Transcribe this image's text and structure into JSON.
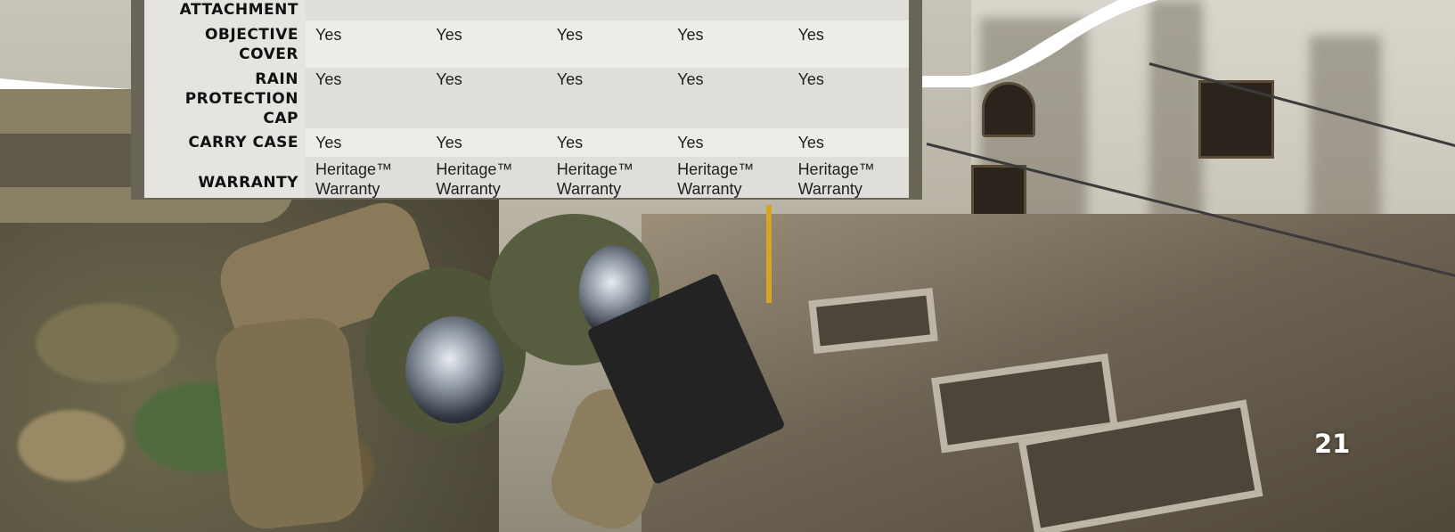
{
  "spec_table": {
    "rows": [
      {
        "label": "ATTACHMENT",
        "values": [
          "",
          "",
          "",
          "",
          ""
        ]
      },
      {
        "label": "OBJECTIVE COVER",
        "values": [
          "Yes",
          "Yes",
          "Yes",
          "Yes",
          "Yes"
        ]
      },
      {
        "label": "RAIN PROTECTION CAP",
        "values": [
          "Yes",
          "Yes",
          "Yes",
          "Yes",
          "Yes"
        ]
      },
      {
        "label": "CARRY CASE",
        "values": [
          "Yes",
          "Yes",
          "Yes",
          "Yes",
          "Yes"
        ]
      },
      {
        "label": "WARRANTY",
        "values": [
          "Heritage™ Warranty",
          "Heritage™ Warranty",
          "Heritage™ Warranty",
          "Heritage™ Warranty",
          "Heritage™ Warranty"
        ]
      }
    ]
  },
  "page_number": "21",
  "colors": {
    "frame": "#6a6657",
    "row_shade": "#e8e7e4",
    "row_light": "#f6f6f4",
    "page_number": "#ffffff"
  }
}
